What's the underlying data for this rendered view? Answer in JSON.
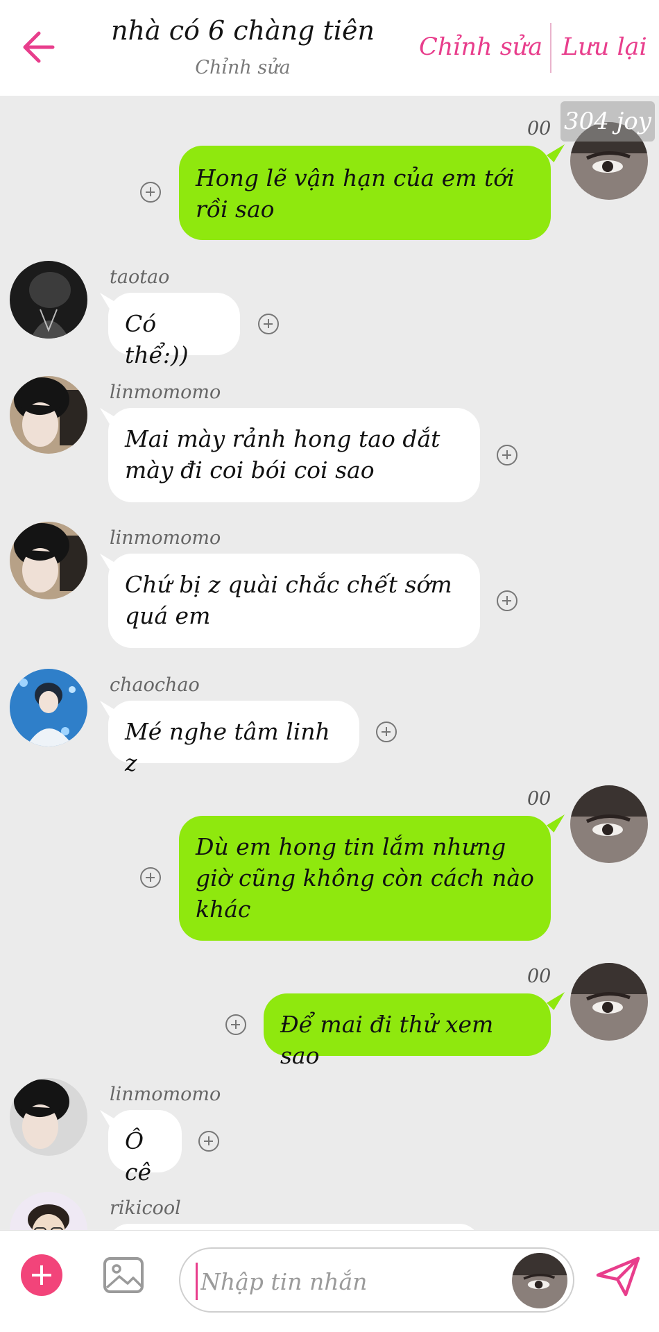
{
  "header": {
    "title": "nhà có 6 chàng tiên",
    "subtitle": "Chỉnh sửa",
    "edit_label": "Chỉnh sửa",
    "save_label": "Lưu lại",
    "back_icon": "arrow-left-icon"
  },
  "watermark": "304 joy",
  "messages": [
    {
      "side": "out",
      "name": "00",
      "lines": [
        "Hong lẽ vận hạn của em tới",
        "rồi sao"
      ]
    },
    {
      "side": "in",
      "name": "taotao",
      "lines": [
        "Có thể:))"
      ]
    },
    {
      "side": "in",
      "name": "linmomomo",
      "lines": [
        "Mai mày rảnh hong tao dắt",
        "mày đi coi bói coi sao"
      ]
    },
    {
      "side": "in",
      "name": "linmomomo",
      "lines": [
        "Chứ bị z quài chắc chết sớm",
        "quá em"
      ]
    },
    {
      "side": "in",
      "name": "chaochao",
      "lines": [
        "Mé nghe tâm linh z"
      ]
    },
    {
      "side": "out",
      "name": "00",
      "lines": [
        "Dù em hong tin lắm nhưng",
        "giờ cũng không còn cách nào",
        "khác"
      ]
    },
    {
      "side": "out",
      "name": "00",
      "lines": [
        "Để mai đi thử xem sao"
      ]
    },
    {
      "side": "in",
      "name": "linmomomo",
      "lines": [
        "Ô cê"
      ]
    },
    {
      "side": "in",
      "name": "rikicool",
      "lines": [
        ""
      ]
    }
  ],
  "composer": {
    "placeholder": "Nhập tin nhắn",
    "value": "",
    "add_icon": "plus-circle-icon",
    "image_icon": "image-icon",
    "send_icon": "paper-plane-icon"
  },
  "colors": {
    "accent": "#e83e8c",
    "add_button": "#f2447a",
    "outgoing_bubble": "#8fe80e",
    "incoming_bubble": "#ffffff",
    "background": "#ebebeb"
  }
}
